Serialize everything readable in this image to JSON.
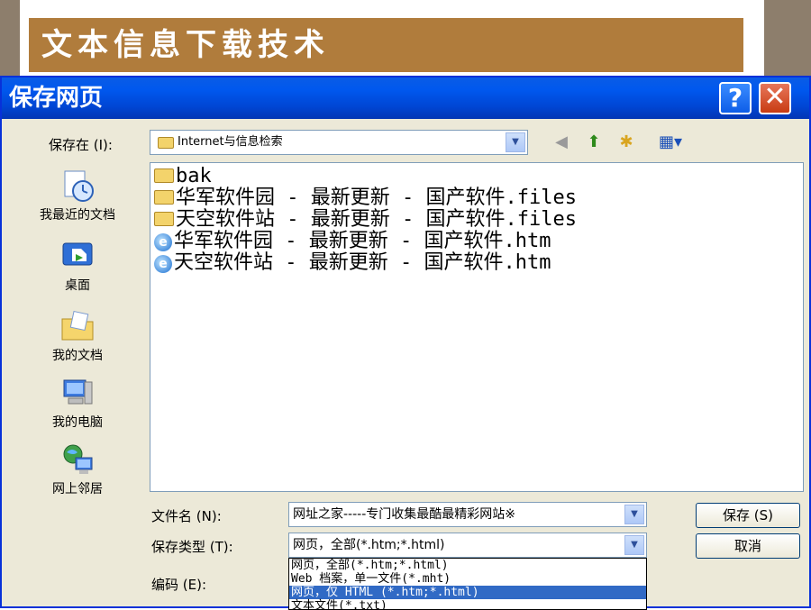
{
  "slide": {
    "title": "文本信息下载技术"
  },
  "dialog": {
    "title": "保存网页",
    "help_label": "?",
    "close_label": "✕",
    "save_in": {
      "label": "保存在 (I):",
      "value": "Internet与信息检索"
    },
    "places": [
      {
        "label": "我最近的文档",
        "icon": "recent-documents-icon"
      },
      {
        "label": "桌面",
        "icon": "desktop-icon"
      },
      {
        "label": "我的文档",
        "icon": "my-documents-icon"
      },
      {
        "label": "我的电脑",
        "icon": "my-computer-icon"
      },
      {
        "label": "网上邻居",
        "icon": "network-places-icon"
      }
    ],
    "files": [
      {
        "name": "bak",
        "type": "folder"
      },
      {
        "name": "华军软件园 - 最新更新 - 国产软件.files",
        "type": "folder"
      },
      {
        "name": "天空软件站 - 最新更新 - 国产软件.files",
        "type": "folder"
      },
      {
        "name": "华军软件园 - 最新更新 - 国产软件.htm",
        "type": "htm"
      },
      {
        "name": "天空软件站 - 最新更新 - 国产软件.htm",
        "type": "htm"
      }
    ],
    "filename": {
      "label": "文件名 (N):",
      "value": "网址之家-----专门收集最酷最精彩网站※"
    },
    "filetype": {
      "label": "保存类型 (T):",
      "value": "网页，全部(*.htm;*.html)",
      "options": [
        "网页，全部(*.htm;*.html)",
        "Web 档案，单一文件(*.mht)",
        "网页，仅 HTML (*.htm;*.html)",
        "文本文件(*.txt)"
      ],
      "highlighted_index": 2
    },
    "encoding": {
      "label": "编码 (E):"
    },
    "save_button": "保存 (S)",
    "cancel_button": "取消"
  },
  "colors": {
    "slide_border": "#8d7e6c",
    "title_bar": "#b07c3c",
    "dialog_titlebar": "#0058ee",
    "dialog_face": "#ece9d8",
    "selection": "#316ac5"
  }
}
